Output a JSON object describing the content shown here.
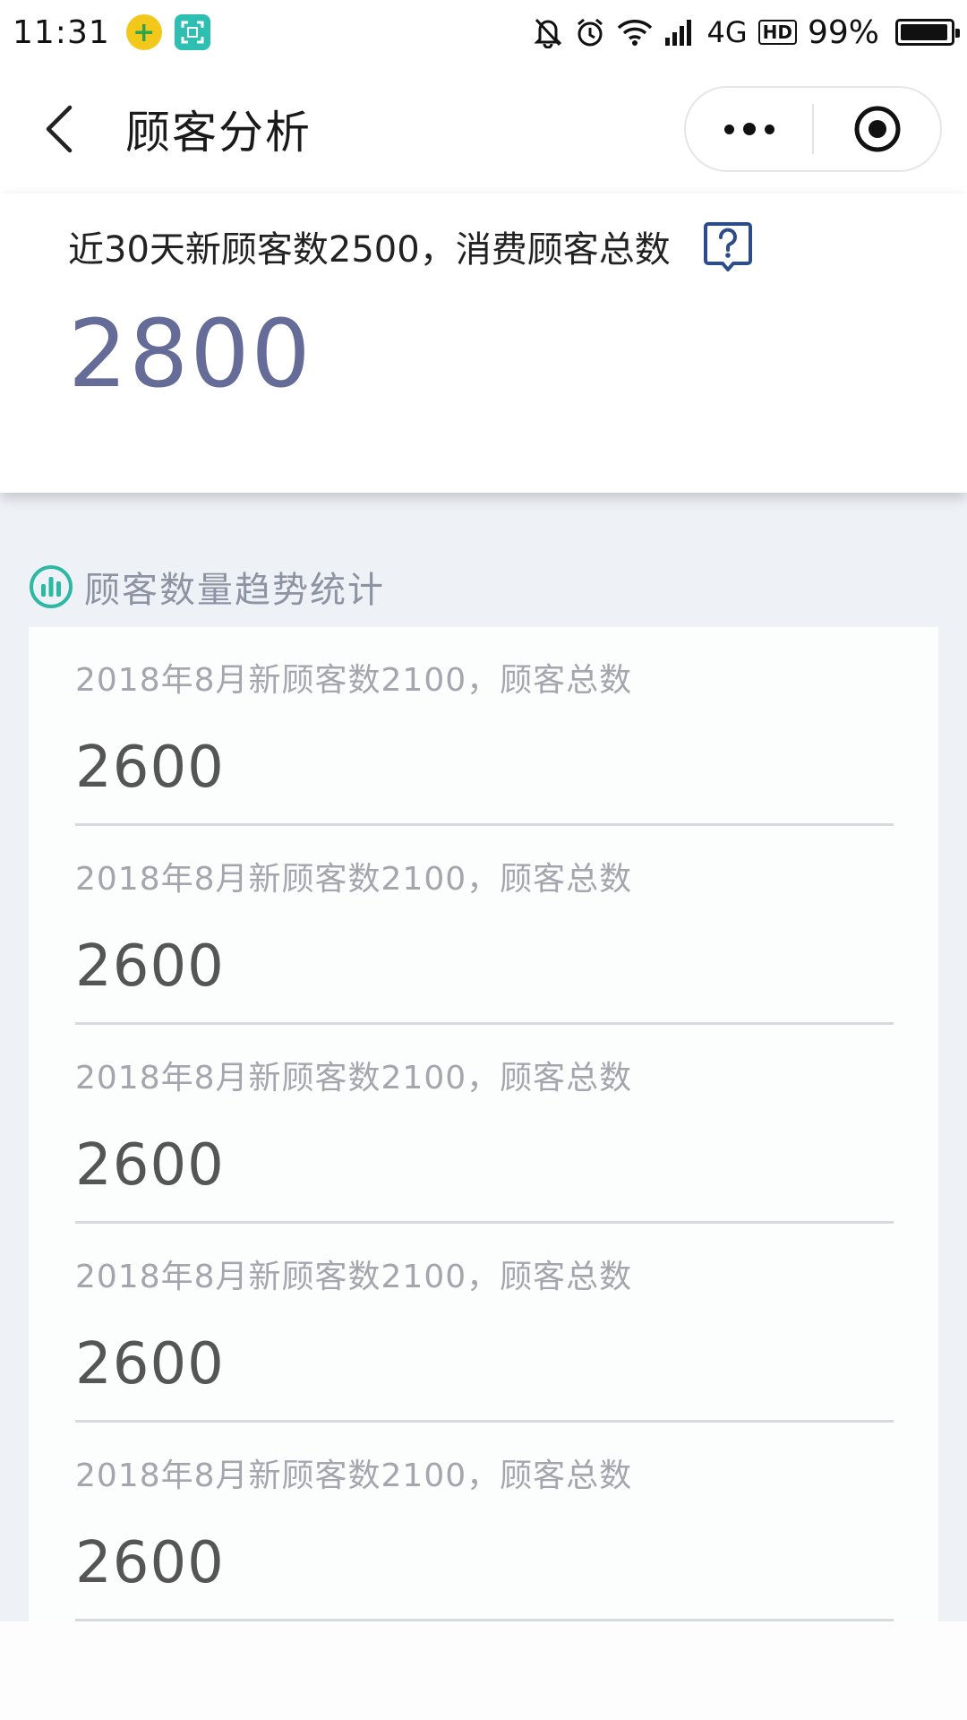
{
  "status_bar": {
    "time": "11:31",
    "network": "4G",
    "hd": "HD",
    "battery": "99%",
    "icons": [
      "app-plus-icon",
      "scan-app-icon",
      "mute-bell-icon",
      "alarm-icon",
      "wifi-icon",
      "signal-icon",
      "battery-icon"
    ]
  },
  "nav": {
    "title": "顾客分析",
    "icons": [
      "back-arrow-icon",
      "more-dots-icon",
      "close-target-icon"
    ]
  },
  "summary": {
    "text": "近30天新顾客数2500，消费顾客总数",
    "total": "2800",
    "help_icon": "question-icon"
  },
  "trend": {
    "title": "顾客数量趋势统计",
    "icon": "bar-chart-icon",
    "items": [
      {
        "label": "2018年8月新顾客数2100，顾客总数",
        "value": "2600"
      },
      {
        "label": "2018年8月新顾客数2100，顾客总数",
        "value": "2600"
      },
      {
        "label": "2018年8月新顾客数2100，顾客总数",
        "value": "2600"
      },
      {
        "label": "2018年8月新顾客数2100，顾客总数",
        "value": "2600"
      },
      {
        "label": "2018年8月新顾客数2100，顾客总数",
        "value": "2600"
      }
    ]
  },
  "colors": {
    "accent_total": "#646c97",
    "section_bg": "#eef2f7",
    "teal_icon": "#2db8a4",
    "help_icon": "#2c4c8c"
  }
}
